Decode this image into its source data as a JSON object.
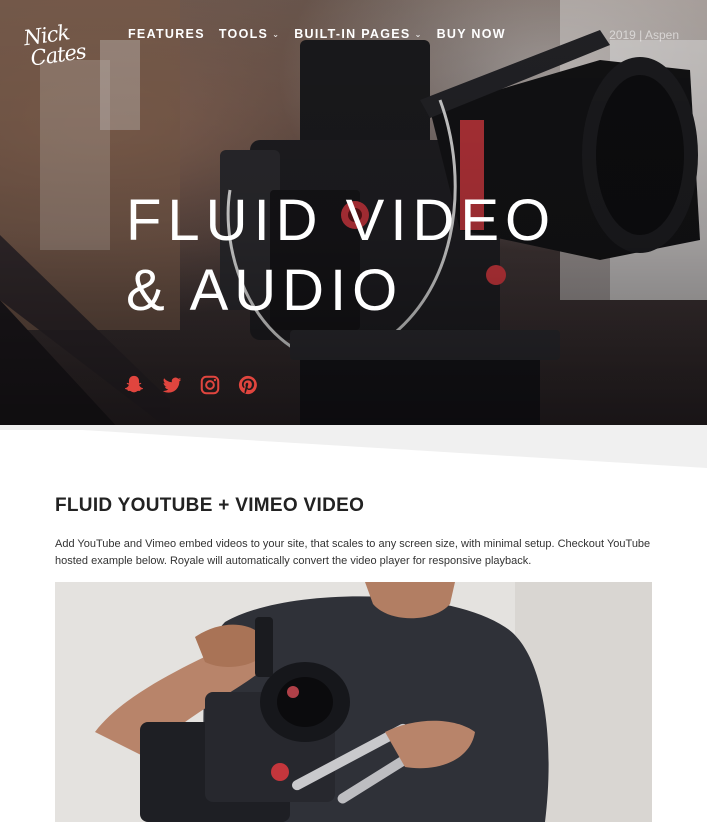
{
  "header": {
    "logo_line1": "Nick",
    "logo_line2": "Cates",
    "nav": [
      {
        "label": "FEATURES",
        "has_dropdown": false
      },
      {
        "label": "TOOLS",
        "has_dropdown": true
      },
      {
        "label": "BUILT-IN PAGES",
        "has_dropdown": true
      },
      {
        "label": "BUY NOW",
        "has_dropdown": false
      }
    ],
    "right_text": "2019 | Aspen"
  },
  "hero": {
    "title_line1": "FLUID VIDEO",
    "title_line2": "& AUDIO",
    "socials": [
      "snapchat-icon",
      "twitter-icon",
      "instagram-icon",
      "pinterest-icon"
    ],
    "accent_color": "#e0453e"
  },
  "section": {
    "title": "FLUID YOUTUBE + VIMEO VIDEO",
    "text": "Add YouTube and Vimeo embed videos to your site, that scales to any screen size, with minimal setup. Checkout YouTube hosted example below. Royale will automatically convert the video player for responsive playback."
  }
}
